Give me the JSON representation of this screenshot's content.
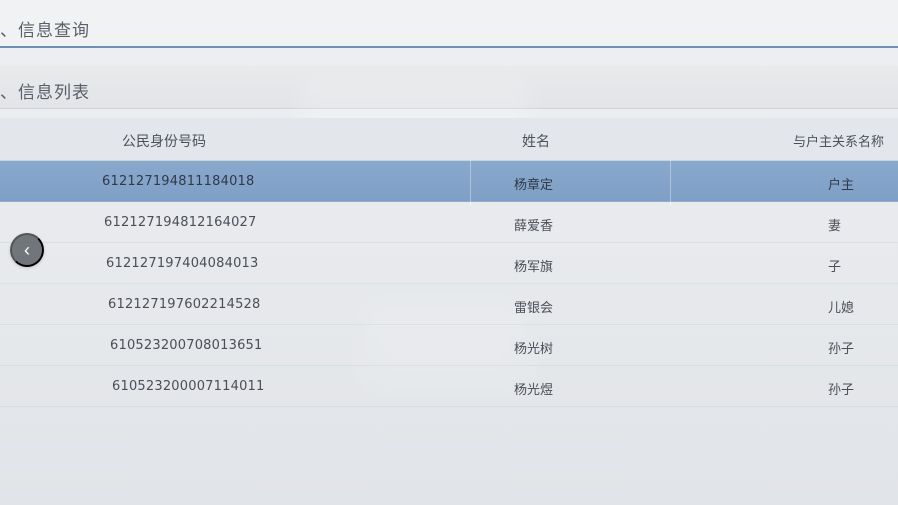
{
  "header": {
    "title": "、信息查询"
  },
  "section": {
    "title": "、信息列表"
  },
  "table": {
    "columns": [
      "公民身份号码",
      "姓名",
      "与户主关系名称"
    ],
    "rows": [
      {
        "id": "612127194811184018",
        "name": "杨章定",
        "relation": "户主",
        "selected": true
      },
      {
        "id": "612127194812164027",
        "name": "薛爱香",
        "relation": "妻",
        "selected": false
      },
      {
        "id": "612127197404084013",
        "name": "杨军旗",
        "relation": "子",
        "selected": false
      },
      {
        "id": "612127197602214528",
        "name": "雷银会",
        "relation": "儿媳",
        "selected": false
      },
      {
        "id": "610523200708013651",
        "name": "杨光树",
        "relation": "孙子",
        "selected": false
      },
      {
        "id": "610523200007114011",
        "name": "杨光煜",
        "relation": "孙子",
        "selected": false
      }
    ]
  },
  "navigation": {
    "back_icon": "chevron-left-icon"
  },
  "colors": {
    "accent": "#6f90b5",
    "selected_row": "#86a6cb",
    "background": "#e9ebee"
  }
}
